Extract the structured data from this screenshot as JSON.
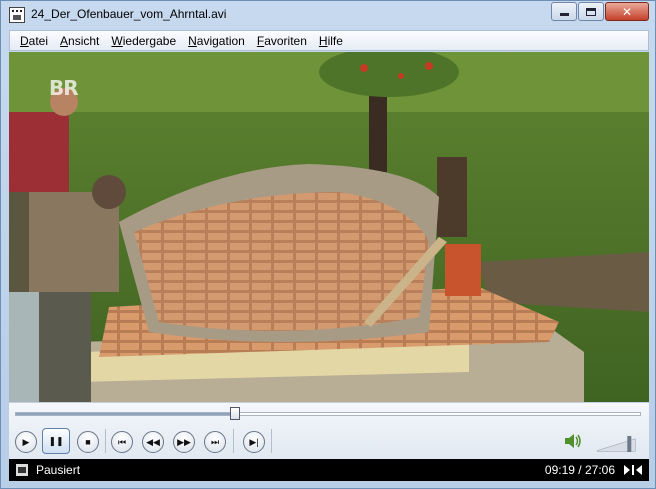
{
  "window": {
    "title": "24_Der_Ofenbauer_vom_Ahrntal.avi",
    "accent": "#c4412a"
  },
  "menu": [
    {
      "label": "Datei",
      "accel": "D",
      "rest": "atei"
    },
    {
      "label": "Ansicht",
      "accel": "A",
      "rest": "nsicht"
    },
    {
      "label": "Wiedergabe",
      "accel": "W",
      "rest": "iedergabe"
    },
    {
      "label": "Navigation",
      "accel": "N",
      "rest": "avigation"
    },
    {
      "label": "Favoriten",
      "accel": "F",
      "rest": "avoriten"
    },
    {
      "label": "Hilfe",
      "accel": "H",
      "rest": "ilfe"
    }
  ],
  "video": {
    "channel_logo": "BR"
  },
  "controls": {
    "seek_progress": 0.3516,
    "volume_level": 0.85,
    "buttons": [
      "play-icon",
      "pause-icon",
      "stop-icon",
      "previous-icon",
      "rewind-icon",
      "fast-forward-icon",
      "next-icon",
      "frame-step-icon"
    ]
  },
  "status": {
    "text": "Pausiert",
    "elapsed": "09:19",
    "separator": " / ",
    "total": "27:06"
  }
}
